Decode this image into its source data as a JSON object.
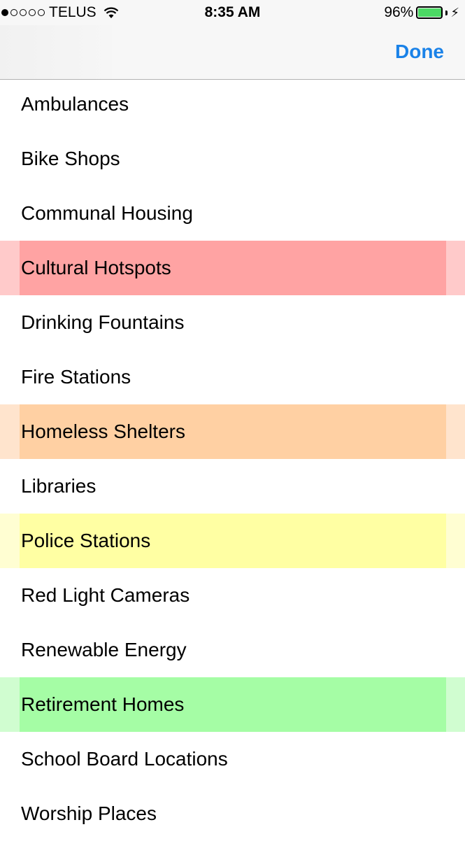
{
  "status_bar": {
    "signal_dots_filled": 1,
    "signal_dots_total": 5,
    "carrier": "TELUS",
    "time": "8:35 AM",
    "battery_percent": "96%",
    "battery_level": 0.96,
    "battery_color": "#4cd964"
  },
  "nav": {
    "done_label": "Done",
    "accent_color": "#1a82e8"
  },
  "items": [
    {
      "label": "Ambulances",
      "highlight": "none"
    },
    {
      "label": "Bike Shops",
      "highlight": "none"
    },
    {
      "label": "Communal Housing",
      "highlight": "none"
    },
    {
      "label": "Cultural Hotspots",
      "highlight": "red"
    },
    {
      "label": "Drinking Fountains",
      "highlight": "none"
    },
    {
      "label": "Fire Stations",
      "highlight": "none"
    },
    {
      "label": "Homeless Shelters",
      "highlight": "orange"
    },
    {
      "label": "Libraries",
      "highlight": "none"
    },
    {
      "label": "Police Stations",
      "highlight": "yellow"
    },
    {
      "label": "Red Light Cameras",
      "highlight": "none"
    },
    {
      "label": "Renewable Energy",
      "highlight": "none"
    },
    {
      "label": "Retirement Homes",
      "highlight": "green"
    },
    {
      "label": "School Board Locations",
      "highlight": "none"
    },
    {
      "label": "Worship Places",
      "highlight": "none"
    }
  ]
}
